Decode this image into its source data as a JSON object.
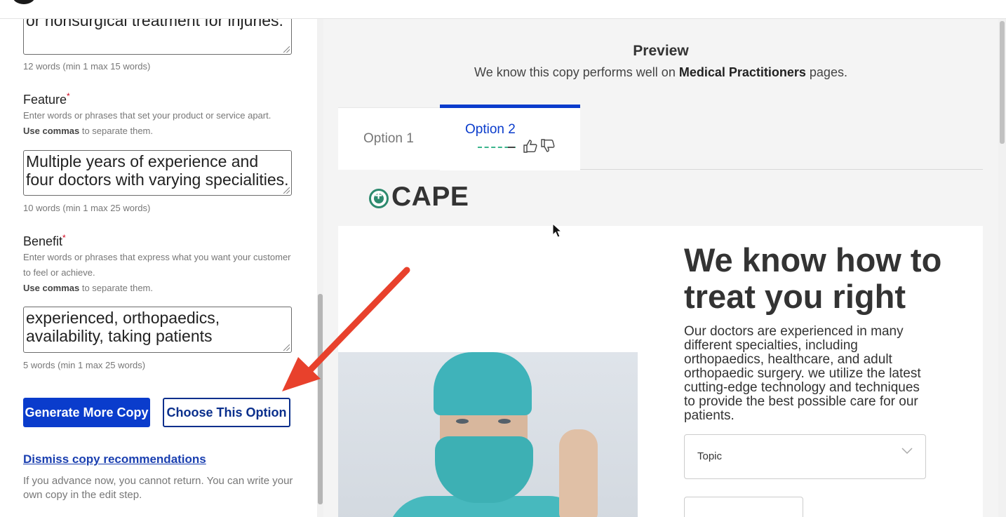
{
  "left": {
    "audience_value": "Patients who are in need of surgical or nonsurgical treatment for injuries.",
    "audience_count": "12 words (min 1 max 15 words)",
    "feature": {
      "title": "Feature",
      "required": "*",
      "hint": "Enter words or phrases that set your product or service apart.",
      "commas_bold": "Use commas",
      "commas_rest": " to separate them.",
      "value": "Multiple years of experience and four doctors with varying specialities.",
      "count": "10 words (min 1 max 25 words)"
    },
    "benefit": {
      "title": "Benefit",
      "required": "*",
      "hint": "Enter words or phrases that express what you want your customer to feel or achieve.",
      "commas_bold": "Use commas",
      "commas_rest": " to separate them.",
      "value": "experienced, orthopaedics, availability, taking patients",
      "count": "5 words (min 1 max 25 words)"
    },
    "generate_label": "Generate More Copy",
    "choose_label": "Choose This Option",
    "dismiss_label": "Dismiss copy recommendations",
    "note": "If you advance now, you cannot return. You can write your own copy in the edit step."
  },
  "preview": {
    "title": "Preview",
    "sub_prefix": "We know this copy performs well on ",
    "sub_bold": "Medical Practitioners",
    "sub_suffix": " pages.",
    "tabs": [
      {
        "label": "Option 1"
      },
      {
        "label": "Option 2"
      }
    ],
    "site": {
      "logo_text": "CAPE",
      "hero_title": "We know how to treat you right",
      "hero_body": "Our doctors are experienced in many different specialties, including orthopaedics, healthcare, and adult orthopaedic surgery. we utilize the latest cutting-edge technology and techniques to provide the best possible care for our patients.",
      "topic_label": "Topic"
    }
  },
  "colors": {
    "primary": "#0a3ccc",
    "annotation_arrow": "#e8412c",
    "logo_green": "#2d8a6e"
  }
}
